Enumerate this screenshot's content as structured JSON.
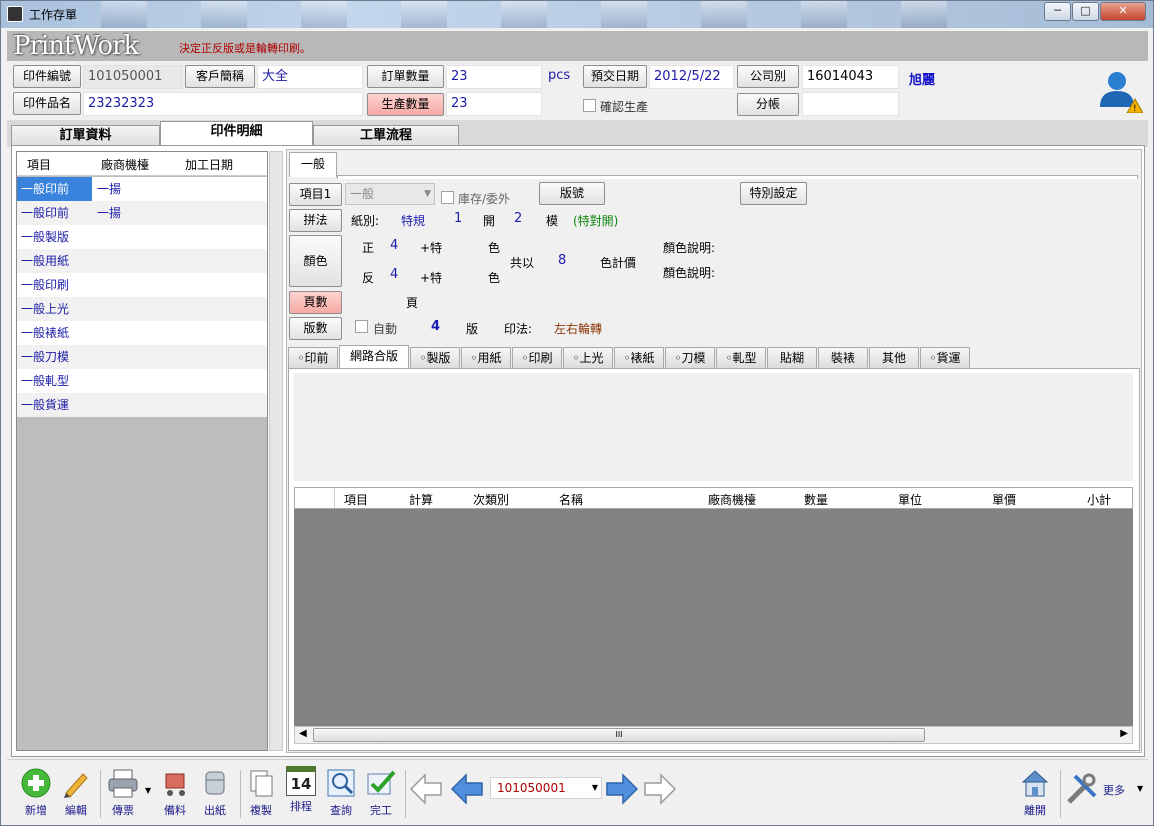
{
  "window": {
    "title": "工作存單",
    "minimize": "─",
    "maximize": "□",
    "close": "✕"
  },
  "header": {
    "logo": "PrintWork",
    "hint": "決定正反版或是輪轉印刷。"
  },
  "form": {
    "print_no_label": "印件編號",
    "print_no": "101050001",
    "customer_label": "客戶簡稱",
    "customer": "大全",
    "order_qty_label": "訂單數量",
    "order_qty": "23",
    "unit": "pcs",
    "due_label": "預交日期",
    "due_date": "2012/5/22",
    "company_label": "公司別",
    "company": "16014043",
    "user": "旭麗",
    "print_name_label": "印件品名",
    "print_name": "23232323",
    "prod_qty_label": "生產數量",
    "prod_qty": "23",
    "confirm_label": "確認生產",
    "account_label": "分帳",
    "account": ""
  },
  "main_tabs": [
    "訂單資料",
    "印件明細",
    "工單流程"
  ],
  "left_panel": {
    "headers": [
      "項目",
      "廠商機檯",
      "加工日期"
    ],
    "rows": [
      {
        "item": "一般印前",
        "vendor": "一揚"
      },
      {
        "item": "一般印前",
        "vendor": "一揚"
      },
      {
        "item": "一般製版",
        "vendor": ""
      },
      {
        "item": "一般用紙",
        "vendor": ""
      },
      {
        "item": "一般印刷",
        "vendor": ""
      },
      {
        "item": "一般上光",
        "vendor": ""
      },
      {
        "item": "一般裱紙",
        "vendor": ""
      },
      {
        "item": "一般刀模",
        "vendor": ""
      },
      {
        "item": "一般軋型",
        "vendor": ""
      },
      {
        "item": "一般貨運",
        "vendor": ""
      }
    ]
  },
  "detail": {
    "tab": "一般",
    "item1_label": "項目1",
    "item1_value": "一般",
    "stock_label": "庫存/委外",
    "plate_no_label": "版號",
    "special_label": "特別設定",
    "layout_label": "拼法",
    "paper_label": "紙別:",
    "paper_value": "特規",
    "open_n": "1",
    "open_label": "開",
    "mo_n": "2",
    "mo_label": "模",
    "special_open": "(特對開)",
    "color_label": "顏色",
    "front_label": "正",
    "front_n": "4",
    "plus_special": "+特",
    "color_word": "色",
    "back_label": "反",
    "back_n": "4",
    "total_label": "共以",
    "total_n": "8",
    "color_price": "色計價",
    "color_desc": "顏色說明:",
    "pages_label": "頁數",
    "page_unit": "頁",
    "plates_label": "版數",
    "auto_label": "自動",
    "plates_n": "4",
    "plate_unit": "版",
    "method_label": "印法:",
    "method_value": "左右輪轉"
  },
  "sub_tabs": [
    "◦印前",
    "網路合版",
    "◦製版",
    "◦用紙",
    "◦印刷",
    "◦上光",
    "◦裱紙",
    "◦刀模",
    "◦軋型",
    "貼糊",
    "裝裱",
    "其他",
    "◦貨運"
  ],
  "grid": {
    "headers": [
      "項目",
      "計算",
      "次類別",
      "名稱",
      "廠商機檯",
      "數量",
      "單位",
      "單價",
      "小計"
    ],
    "scroll_thumb": "III"
  },
  "toolbar": {
    "buttons": [
      "新增",
      "編輯",
      "傳票",
      "備料",
      "出紙",
      "複製",
      "排程",
      "查詢",
      "完工"
    ],
    "calendar_day": "14",
    "nav_value": "101050001",
    "exit": "離開",
    "more": "更多"
  },
  "colors": {
    "accent_red": "#b00000",
    "link_blue": "#1c1cb0",
    "pink_btn": "#f5a9a4"
  }
}
